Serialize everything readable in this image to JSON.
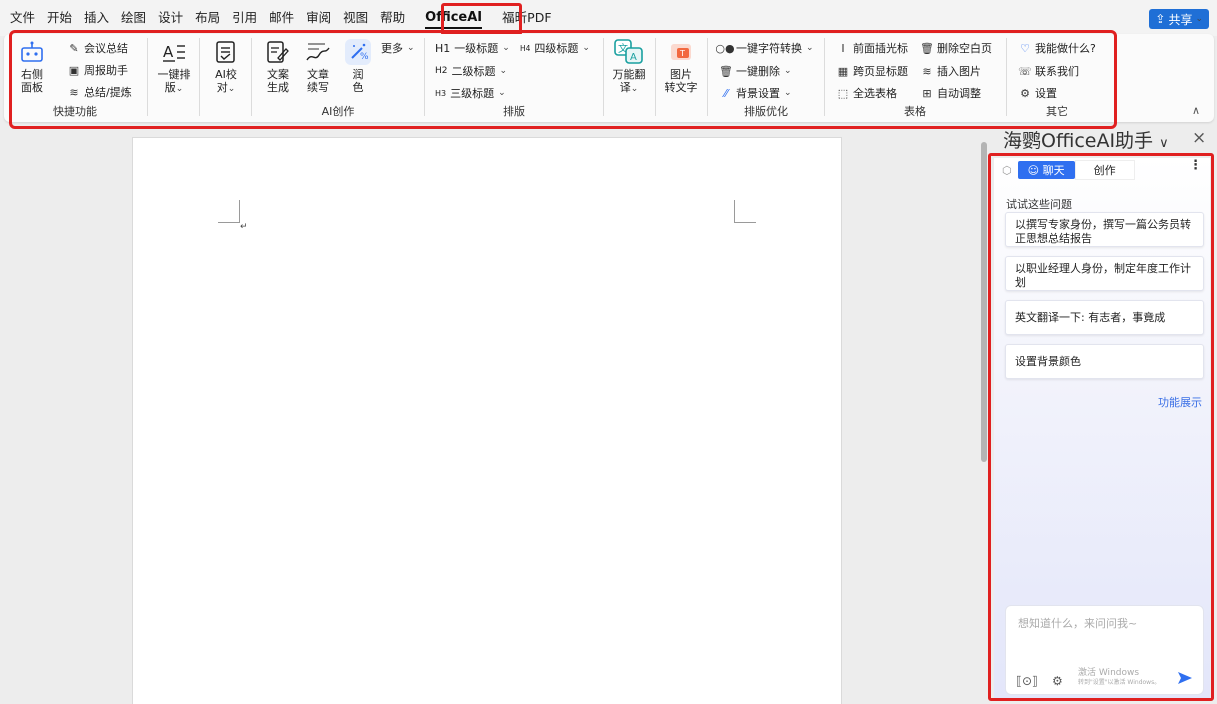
{
  "menubar": {
    "items": [
      "文件",
      "开始",
      "插入",
      "绘图",
      "设计",
      "布局",
      "引用",
      "邮件",
      "审阅",
      "视图",
      "帮助"
    ],
    "active_tab": "OfficeAI",
    "extra_tab": "福昕PDF",
    "share_label": "共享"
  },
  "ribbon": {
    "quick": {
      "label": "快捷功能",
      "panel_btn": [
        "右侧",
        "面板"
      ],
      "meeting": "会议总结",
      "weekly": "周报助手",
      "summary": "总结/提炼"
    },
    "layout_btn": [
      "一键排",
      "版"
    ],
    "proof_btn": [
      "AI校",
      "对"
    ],
    "ai": {
      "label": "AI创作",
      "gen": [
        "文案",
        "生成"
      ],
      "cont": [
        "文章",
        "续写"
      ],
      "polish": [
        "润",
        "色"
      ],
      "more": "更多"
    },
    "typeset": {
      "label": "排版",
      "h1": "一级标题",
      "h2": "二级标题",
      "h3": "三级标题",
      "h4": "四级标题"
    },
    "translate_btn": [
      "万能翻",
      "译"
    ],
    "img_btn": [
      "图片",
      "转文字"
    ],
    "opt": {
      "label": "排版优化",
      "convert": "一键字符转换",
      "delete": "一键删除",
      "bg": "背景设置"
    },
    "table": {
      "label": "表格",
      "cursor": "前面插光标",
      "del_blank": "删除空白页",
      "cross_title": "跨页显标题",
      "insert_img": "插入图片",
      "select_all": "全选表格",
      "auto_adjust": "自动调整"
    },
    "other": {
      "label": "其它",
      "help": "我能做什么?",
      "contact": "联系我们",
      "settings": "设置"
    }
  },
  "panel": {
    "title": "海鹦OfficeAI助手",
    "tab_chat": "聊天",
    "tab_create": "创作",
    "try_label": "试试这些问题",
    "suggestions": [
      "以撰写专家身份，撰写一篇公务员转正思想总结报告",
      "以职业经理人身份，制定年度工作计划",
      "英文翻译一下: 有志者，事竟成",
      "设置背景颜色"
    ],
    "feature_link": "功能展示",
    "input_placeholder": "想知道什么，来问问我~",
    "watermark_1": "激活 Windows",
    "watermark_2": "转到\"设置\"以激活 Windows。"
  },
  "colors": {
    "accent": "#2f6ff0",
    "highlight": "#e02020",
    "share": "#1f6fd6"
  }
}
